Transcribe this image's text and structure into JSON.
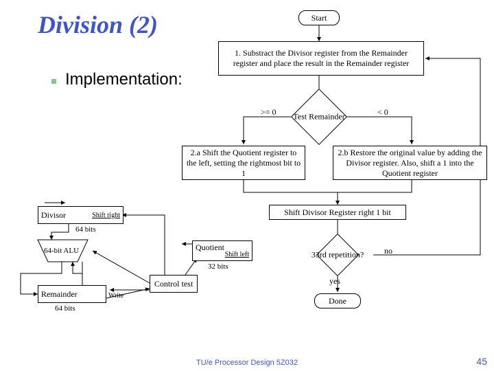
{
  "title": "Division (2)",
  "bullet": "Implementation:",
  "flowchart": {
    "start": "Start",
    "step1": "1. Substract the Divisor register from the Remainder register and place the result in the Remainder register",
    "test": "Test Remainder",
    "ge0": ">= 0",
    "lt0": "< 0",
    "step2a": "2.a Shift the Quotient register to the left, setting the rightmost bit to 1",
    "step2b": "2.b Restore the original value by adding the Divisor register. Also, shift a 1 into the Quotient register",
    "shiftdiv": "Shift Divisor Register right 1 bit",
    "rep": "33rd repetition?",
    "no": "no",
    "yes": "yes",
    "done": "Done"
  },
  "datapath": {
    "divisor": "Divisor",
    "shift_right": "Shift right",
    "bits64a": "64 bits",
    "alu": "64-bit ALU",
    "quotient": "Quotient",
    "shift_left": "Shift left",
    "bits32": "32 bits",
    "remainder": "Remainder",
    "write": "Write",
    "bits64b": "64 bits",
    "control": "Control test"
  },
  "footer": {
    "center": "TU/e Processor Design 5Z032",
    "right": "45"
  },
  "chart_data": {
    "type": "flowchart",
    "nodes": [
      {
        "id": "start",
        "shape": "terminator",
        "label": "Start"
      },
      {
        "id": "s1",
        "shape": "process",
        "label": "1. Subtract Divisor from Remainder; result → Remainder"
      },
      {
        "id": "test",
        "shape": "decision",
        "label": "Test Remainder"
      },
      {
        "id": "s2a",
        "shape": "process",
        "label": "2.a Shift Quotient left, set LSB=1"
      },
      {
        "id": "s2b",
        "shape": "process",
        "label": "2.b Restore (add Divisor); shift 1 into Quotient"
      },
      {
        "id": "shiftdiv",
        "shape": "process",
        "label": "Shift Divisor Register right 1 bit"
      },
      {
        "id": "rep",
        "shape": "decision",
        "label": "33rd repetition?"
      },
      {
        "id": "done",
        "shape": "terminator",
        "label": "Done"
      }
    ],
    "edges": [
      {
        "from": "start",
        "to": "s1"
      },
      {
        "from": "s1",
        "to": "test"
      },
      {
        "from": "test",
        "to": "s2a",
        "label": ">= 0"
      },
      {
        "from": "test",
        "to": "s2b",
        "label": "< 0"
      },
      {
        "from": "s2a",
        "to": "shiftdiv"
      },
      {
        "from": "s2b",
        "to": "shiftdiv"
      },
      {
        "from": "shiftdiv",
        "to": "rep"
      },
      {
        "from": "rep",
        "to": "s1",
        "label": "no"
      },
      {
        "from": "rep",
        "to": "done",
        "label": "yes"
      }
    ],
    "datapath_blocks": [
      "Divisor (64 bits, shift right)",
      "64-bit ALU",
      "Quotient (32 bits, shift left)",
      "Remainder (64 bits, write)",
      "Control test"
    ]
  }
}
